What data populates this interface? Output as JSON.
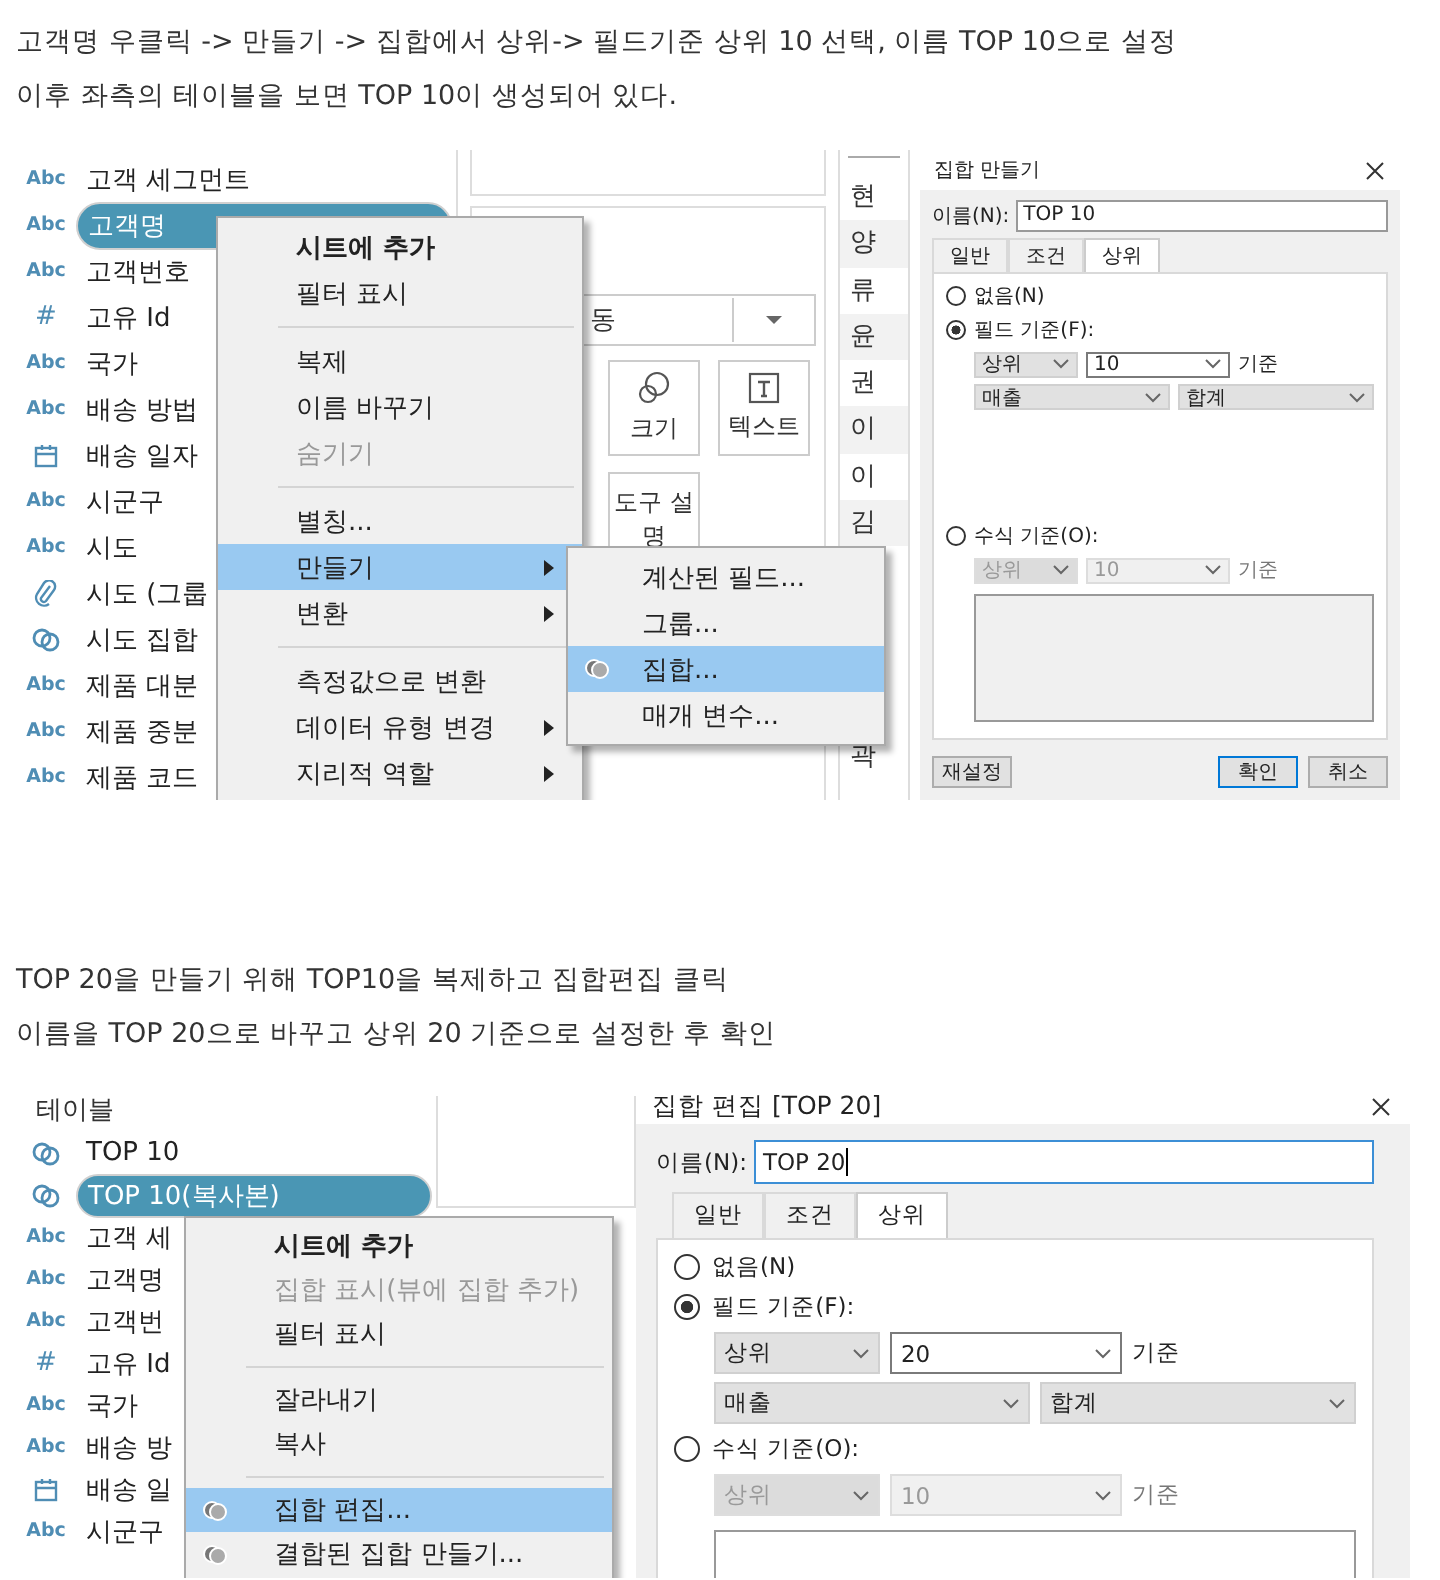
{
  "intro": [
    "고객명 우클릭 -> 만들기 -> 집합에서 상위-> 필드기준 상위 10 선택, 이름 TOP 10으로 설정",
    "이후 좌측의 테이블을 보면 TOP 10이 생성되어 있다."
  ],
  "screenshot_1": {
    "field_list": [
      {
        "kind": "string",
        "glyph": "Abc",
        "label": "고객 세그먼트",
        "selected": false
      },
      {
        "kind": "string",
        "glyph": "Abc",
        "label": "고객명",
        "selected": true
      },
      {
        "kind": "string",
        "glyph": "Abc",
        "label": "고객번호",
        "selected": false
      },
      {
        "kind": "number",
        "glyph": "#",
        "label": "고유 Id",
        "selected": false
      },
      {
        "kind": "string",
        "glyph": "Abc",
        "label": "국가",
        "selected": false
      },
      {
        "kind": "string",
        "glyph": "Abc",
        "label": "배송 방법",
        "selected": false
      },
      {
        "kind": "date",
        "label": "배송 일자",
        "selected": false
      },
      {
        "kind": "string",
        "glyph": "Abc",
        "label": "시군구",
        "selected": false
      },
      {
        "kind": "string",
        "glyph": "Abc",
        "label": "시도",
        "selected": false
      },
      {
        "kind": "group",
        "label": "시도 (그룹",
        "selected": false
      },
      {
        "kind": "set",
        "label": "시도 집합",
        "selected": false
      },
      {
        "kind": "string",
        "glyph": "Abc",
        "label": "제품 대분",
        "selected": false
      },
      {
        "kind": "string",
        "glyph": "Abc",
        "label": "제품 중분",
        "selected": false
      },
      {
        "kind": "string",
        "glyph": "Abc",
        "label": "제품 코드",
        "selected": false
      }
    ],
    "marks_card": {
      "dropdown": "동",
      "buttons": [
        {
          "kind": "size",
          "label": "크기"
        },
        {
          "kind": "text",
          "label": "텍스트"
        },
        {
          "kind": "plain",
          "label": "도구 설명"
        }
      ]
    },
    "name_column": {
      "rows": [
        "현",
        "양",
        "류",
        "윤",
        "권",
        "이",
        "이",
        "김"
      ],
      "last_row": "곽"
    },
    "context_menu": {
      "items": [
        {
          "kind": "item",
          "label": "시트에 추가",
          "bold": true,
          "disabled": false,
          "selected": false,
          "submenu": false
        },
        {
          "kind": "item",
          "label": "필터 표시",
          "bold": false,
          "disabled": false,
          "selected": false,
          "submenu": false
        },
        {
          "kind": "separator"
        },
        {
          "kind": "item",
          "label": "복제",
          "bold": false,
          "disabled": false,
          "selected": false,
          "submenu": false
        },
        {
          "kind": "item",
          "label": "이름 바꾸기",
          "bold": false,
          "disabled": false,
          "selected": false,
          "submenu": false
        },
        {
          "kind": "item",
          "label": "숨기기",
          "bold": false,
          "disabled": true,
          "selected": false,
          "submenu": false
        },
        {
          "kind": "separator"
        },
        {
          "kind": "item",
          "label": "별칭...",
          "bold": false,
          "disabled": false,
          "selected": false,
          "submenu": false
        },
        {
          "kind": "item",
          "label": "만들기",
          "bold": false,
          "disabled": false,
          "selected": true,
          "submenu": true
        },
        {
          "kind": "item",
          "label": "변환",
          "bold": false,
          "disabled": false,
          "selected": false,
          "submenu": true
        },
        {
          "kind": "separator"
        },
        {
          "kind": "item",
          "label": "측정값으로 변환",
          "bold": false,
          "disabled": false,
          "selected": false,
          "submenu": false
        },
        {
          "kind": "item",
          "label": "데이터 유형 변경",
          "bold": false,
          "disabled": false,
          "selected": false,
          "submenu": true
        },
        {
          "kind": "item",
          "label": "지리적 역할",
          "bold": false,
          "disabled": false,
          "selected": false,
          "submenu": true
        }
      ]
    },
    "submenu": {
      "items": [
        {
          "kind": "item",
          "label": "계산된 필드...",
          "bold": false,
          "disabled": false,
          "selected": false,
          "submenu": false
        },
        {
          "kind": "item",
          "label": "그룹...",
          "bold": false,
          "disabled": false,
          "selected": false,
          "submenu": false
        },
        {
          "kind": "set_item",
          "label": "집합...",
          "bold": false,
          "disabled": false,
          "selected": true,
          "submenu": false
        },
        {
          "kind": "item",
          "label": "매개 변수...",
          "bold": false,
          "disabled": false,
          "selected": false,
          "submenu": false
        }
      ]
    },
    "dialog": {
      "title": "집합 만들기",
      "name_label": "이름(N):",
      "name_value": "TOP 10",
      "name_focused": false,
      "tabs": [
        {
          "label": "일반",
          "selected": false
        },
        {
          "label": "조건",
          "selected": false
        },
        {
          "label": "상위",
          "selected": true
        }
      ],
      "options": [
        {
          "label": "없음(N)",
          "selected": false
        },
        {
          "label": "필드 기준(F):",
          "selected": true,
          "controls": {
            "disabled": false,
            "rows": [
              {
                "kind": "selects",
                "selects": [
                  {
                    "value": "상위",
                    "editable": false
                  },
                  {
                    "value": "10",
                    "editable": true
                  }
                ],
                "suffix": "기준"
              },
              {
                "kind": "selects",
                "selects": [
                  {
                    "value": "매출",
                    "editable": false
                  },
                  {
                    "value": "합계",
                    "editable": false
                  }
                ]
              }
            ]
          }
        },
        {
          "label": "수식 기준(O):",
          "selected": false,
          "controls": {
            "disabled": true,
            "rows": [
              {
                "kind": "selects",
                "selects": [
                  {
                    "value": "상위",
                    "editable": false
                  },
                  {
                    "value": "10",
                    "editable": true
                  }
                ],
                "suffix": "기준"
              },
              {
                "kind": "text_area"
              }
            ]
          }
        }
      ],
      "buttons": [
        {
          "label": "재설정",
          "default": false
        },
        {
          "label": "확인",
          "default": true
        },
        {
          "label": "취소",
          "default": false
        }
      ]
    }
  },
  "middle_text": [
    "TOP 20을 만들기 위해 TOP10을 복제하고 집합편집 클릭",
    "이름을 TOP 20으로 바꾸고 상위 20 기준으로 설정한 후 확인"
  ],
  "screenshot_2": {
    "list_header": "테이블",
    "field_list": [
      {
        "kind": "set",
        "label": "TOP 10",
        "selected": false
      },
      {
        "kind": "set",
        "label": "TOP 10(복사본)",
        "selected": true
      },
      {
        "kind": "string",
        "glyph": "Abc",
        "label": "고객 세",
        "selected": false
      },
      {
        "kind": "string",
        "glyph": "Abc",
        "label": "고객명",
        "selected": false
      },
      {
        "kind": "string",
        "glyph": "Abc",
        "label": "고객번",
        "selected": false
      },
      {
        "kind": "number",
        "glyph": "#",
        "label": "고유 Id",
        "selected": false
      },
      {
        "kind": "string",
        "glyph": "Abc",
        "label": "국가",
        "selected": false
      },
      {
        "kind": "string",
        "glyph": "Abc",
        "label": "배송 방",
        "selected": false
      },
      {
        "kind": "date",
        "label": "배송 일",
        "selected": false
      },
      {
        "kind": "string",
        "glyph": "Abc",
        "label": "시군구",
        "selected": false
      }
    ],
    "context_menu": {
      "items": [
        {
          "kind": "item",
          "label": "시트에 추가",
          "bold": true,
          "disabled": false,
          "selected": false,
          "submenu": false
        },
        {
          "kind": "item",
          "label": "집합 표시(뷰에 집합 추가)",
          "bold": false,
          "disabled": true,
          "selected": false,
          "submenu": false
        },
        {
          "kind": "item",
          "label": "필터 표시",
          "bold": false,
          "disabled": false,
          "selected": false,
          "submenu": false
        },
        {
          "kind": "separator"
        },
        {
          "kind": "item",
          "label": "잘라내기",
          "bold": false,
          "disabled": false,
          "selected": false,
          "submenu": false
        },
        {
          "kind": "item",
          "label": "복사",
          "bold": false,
          "disabled": false,
          "selected": false,
          "submenu": false
        },
        {
          "kind": "separator"
        },
        {
          "kind": "set_item",
          "label": "집합 편집...",
          "bold": false,
          "disabled": false,
          "selected": true,
          "submenu": false
        },
        {
          "kind": "set_item",
          "label": "결합된 집합 만들기...",
          "bold": false,
          "disabled": false,
          "selected": false,
          "submenu": false
        }
      ]
    },
    "dialog": {
      "title": "집합 편집 [TOP 20]",
      "name_label": "이름(N):",
      "name_value": "TOP 20",
      "name_focused": true,
      "tabs": [
        {
          "label": "일반",
          "selected": false
        },
        {
          "label": "조건",
          "selected": false
        },
        {
          "label": "상위",
          "selected": true
        }
      ],
      "options": [
        {
          "label": "없음(N)",
          "selected": false
        },
        {
          "label": "필드 기준(F):",
          "selected": true,
          "controls": {
            "disabled": false,
            "rows": [
              {
                "kind": "selects",
                "selects": [
                  {
                    "value": "상위",
                    "editable": false
                  },
                  {
                    "value": "20",
                    "editable": true
                  }
                ],
                "suffix": "기준"
              },
              {
                "kind": "selects",
                "selects": [
                  {
                    "value": "매출",
                    "editable": false
                  },
                  {
                    "value": "합계",
                    "editable": false
                  }
                ]
              }
            ]
          }
        },
        {
          "label": "수식 기준(O):",
          "selected": false,
          "controls": {
            "disabled": true,
            "rows": [
              {
                "kind": "selects",
                "selects": [
                  {
                    "value": "상위",
                    "editable": false
                  },
                  {
                    "value": "10",
                    "editable": true
                  }
                ],
                "suffix": "기준"
              },
              {
                "kind": "text_area"
              }
            ]
          }
        }
      ]
    }
  }
}
